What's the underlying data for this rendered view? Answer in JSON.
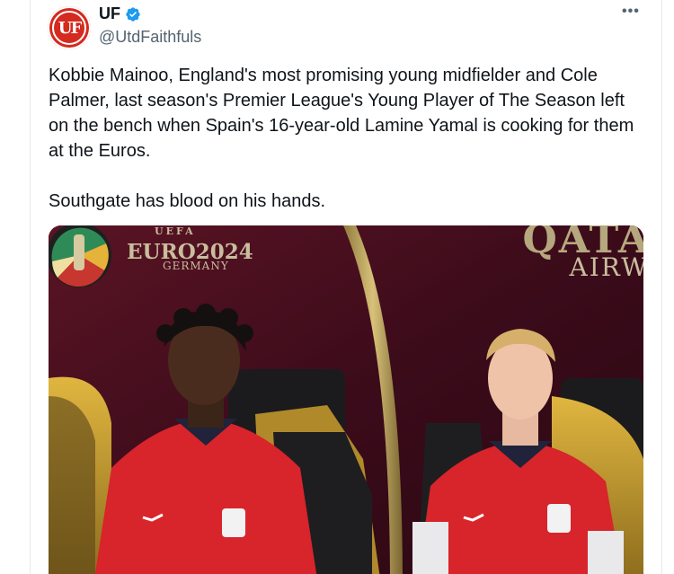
{
  "account": {
    "avatar_text": "UF",
    "display_name": "UF",
    "handle": "@UtdFaithfuls",
    "verified_icon": "verified-badge-icon",
    "more_icon": "more-options-icon",
    "more_glyph": "•••"
  },
  "tweet": {
    "text": "Kobbie Mainoo, England's most promising young midfielder and Cole Palmer, last season's Premier League's Young Player of The Season left on the bench when Spain's 16-year-old Lamine Yamal is cooking for them at the Euros.\n\nSouthgate has blood on his hands."
  },
  "media": {
    "uefa": "UEFA",
    "euro": "EURO2024",
    "germany": "GERMANY",
    "sponsor_top": "QATA",
    "sponsor_bottom": "AIRW"
  },
  "colors": {
    "brand_red": "#d42a1f",
    "verified_blue": "#1d9bf0",
    "text_primary": "#0f1419",
    "text_secondary": "#536471",
    "kit_red": "#d8242b"
  }
}
